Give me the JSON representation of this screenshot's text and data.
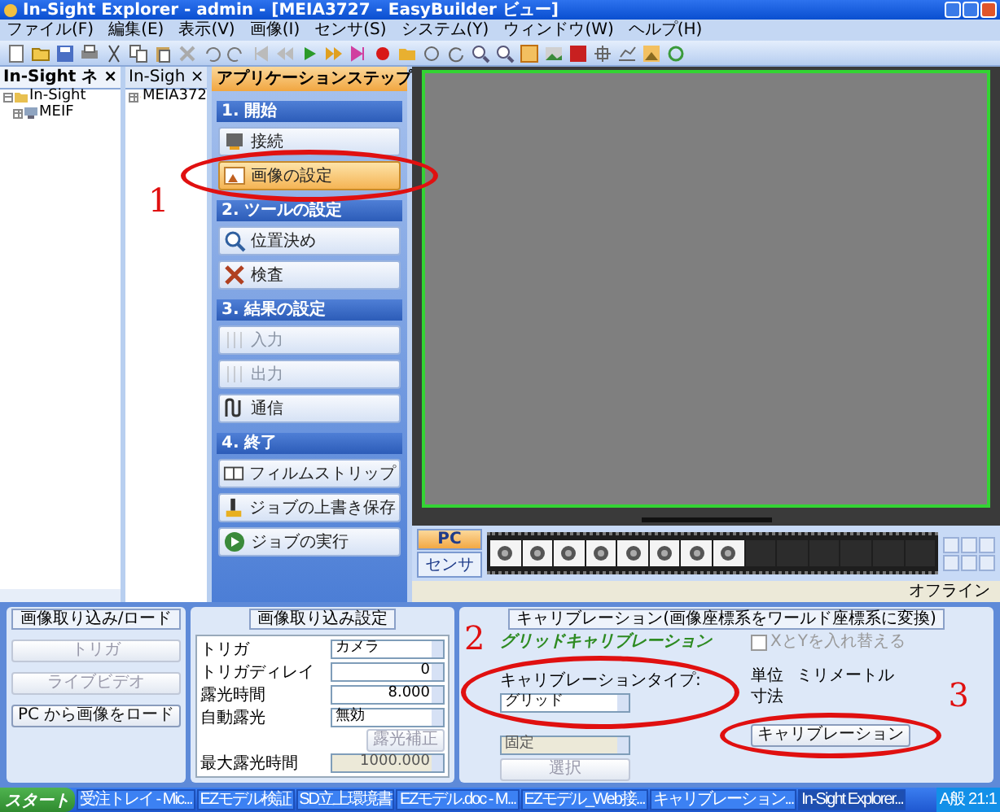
{
  "window": {
    "title": "In-Sight Explorer - admin - [MEIA3727 - EasyBuilder ビュー]"
  },
  "menu": [
    "ファイル(F)",
    "編集(E)",
    "表示(V)",
    "画像(I)",
    "センサ(S)",
    "システム(Y)",
    "ウィンドウ(W)",
    "ヘルプ(H)"
  ],
  "panes": [
    {
      "title": "In-Sight ネ",
      "close": "×",
      "selected": true,
      "tree": [
        {
          "label": "In-Sight",
          "expanded": true,
          "children": [
            {
              "label": "MEIF",
              "expanded": false
            }
          ]
        }
      ]
    },
    {
      "title": "In-Sigh",
      "close": "×",
      "selected": false,
      "tree": [
        {
          "label": "MEIA372",
          "expanded": false
        }
      ]
    }
  ],
  "steps": {
    "title": "アプリケーションステップ",
    "groups": [
      {
        "title": "1. 開始",
        "items": [
          {
            "label": "接続",
            "selected": false,
            "disabled": false
          },
          {
            "label": "画像の設定",
            "selected": true,
            "disabled": false
          }
        ]
      },
      {
        "title": "2. ツールの設定",
        "items": [
          {
            "label": "位置決め",
            "selected": false,
            "disabled": false
          },
          {
            "label": "検査",
            "selected": false,
            "disabled": false
          }
        ]
      },
      {
        "title": "3. 結果の設定",
        "items": [
          {
            "label": "入力",
            "selected": false,
            "disabled": true
          },
          {
            "label": "出力",
            "selected": false,
            "disabled": true
          },
          {
            "label": "通信",
            "selected": false,
            "disabled": false
          }
        ]
      },
      {
        "title": "4. 終了",
        "items": [
          {
            "label": "フィルムストリップ",
            "selected": false,
            "disabled": false
          },
          {
            "label": "ジョブの上書き保存",
            "selected": false,
            "disabled": false
          },
          {
            "label": "ジョブの実行",
            "selected": false,
            "disabled": false
          }
        ]
      }
    ]
  },
  "filmstrip": {
    "sources": [
      {
        "label": "PC",
        "selected": true
      },
      {
        "label": "センサ",
        "selected": false
      }
    ],
    "frames": [
      {
        "filled": true
      },
      {
        "filled": true
      },
      {
        "filled": true
      },
      {
        "filled": true
      },
      {
        "filled": true
      },
      {
        "filled": true
      },
      {
        "filled": true
      },
      {
        "filled": true
      },
      {
        "filled": false
      },
      {
        "filled": false
      },
      {
        "filled": false
      },
      {
        "filled": false
      },
      {
        "filled": false
      },
      {
        "filled": false
      }
    ]
  },
  "status_bar": {
    "text": "オフライン"
  },
  "acquire": {
    "title": "画像取り込み/ロード",
    "buttons": [
      {
        "label": "トリガ",
        "disabled": true
      },
      {
        "label": "ライブビデオ",
        "disabled": true
      },
      {
        "label": "PC から画像をロード",
        "disabled": false
      }
    ]
  },
  "settings": {
    "title": "画像取り込み設定",
    "rows": [
      {
        "kind": "dropdown",
        "label": "トリガ",
        "value": "カメラ",
        "disabled": false
      },
      {
        "kind": "spinner",
        "label": "トリガディレイ",
        "value": "0",
        "disabled": false
      },
      {
        "kind": "spinner",
        "label": "露光時間",
        "value": "8.000",
        "disabled": false
      },
      {
        "kind": "dropdown",
        "label": "自動露光",
        "value": "無効",
        "disabled": false
      },
      {
        "kind": "button",
        "label": "露光補正",
        "disabled": true
      },
      {
        "kind": "spinner",
        "label": "最大露光時間",
        "value": "1000.000",
        "disabled": true
      }
    ]
  },
  "calibration": {
    "title": "キャリブレーション(画像座標系をワールド座標系に変換)",
    "heading": "グリッドキャリブレーション",
    "type_label": "キャリブレーションタイプ:",
    "type_value": "グリッド",
    "origin_value": "固定",
    "select_button": "選択",
    "swap": {
      "label": "XとYを入れ替える",
      "checked": false,
      "disabled": true
    },
    "unit_label": "単位",
    "unit_value": "ミリメートル",
    "size_label": "寸法",
    "button": "キャリブレーション"
  },
  "annotations": [
    {
      "label": "1"
    },
    {
      "label": "2"
    },
    {
      "label": "3"
    }
  ],
  "taskbar": {
    "start": "スタート",
    "tasks": [
      {
        "label": "受注トレイ - Mic...",
        "selected": false
      },
      {
        "label": "EZモデル検証",
        "selected": false
      },
      {
        "label": "SD立上環境書",
        "selected": false
      },
      {
        "label": "EZモデル.doc - M...",
        "selected": false
      },
      {
        "label": "EZモデル_Web接...",
        "selected": false
      },
      {
        "label": "キャリブレーション...",
        "selected": false
      },
      {
        "label": "In-Sight Explorer...",
        "selected": true
      }
    ],
    "tray": "A般",
    "clock": "21:1"
  }
}
